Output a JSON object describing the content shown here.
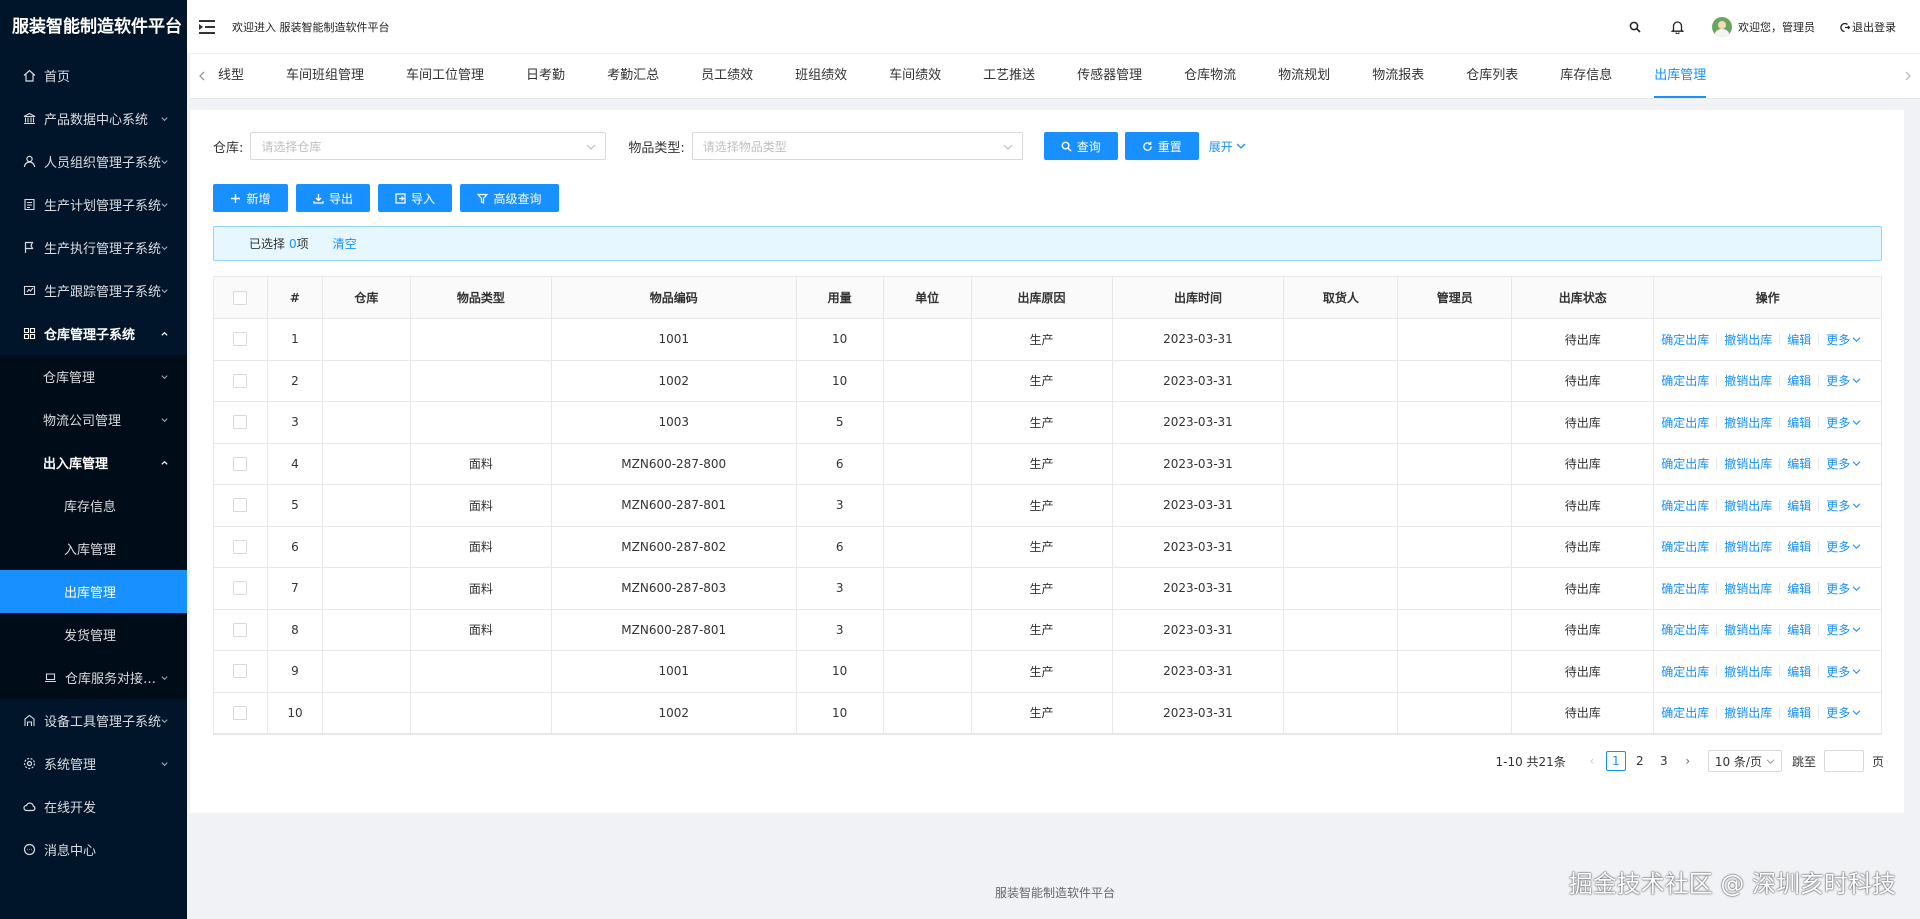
{
  "app": {
    "title": "服装智能制造软件平台",
    "welcome": "欢迎进入 服装智能制造软件平台",
    "user_greeting": "欢迎您，管理员",
    "logout": "退出登录",
    "footer": "服装智能制造软件平台",
    "watermark": "掘金技术社区 @ 深圳亥时科技"
  },
  "sidebar": {
    "items": [
      {
        "label": "首页",
        "icon": "home-icon"
      },
      {
        "label": "产品数据中心系统",
        "icon": "bank-icon"
      },
      {
        "label": "人员组织管理子系统",
        "icon": "user-icon"
      },
      {
        "label": "生产计划管理子系统",
        "icon": "schedule-icon"
      },
      {
        "label": "生产执行管理子系统",
        "icon": "flag-icon"
      },
      {
        "label": "生产跟踪管理子系统",
        "icon": "track-icon"
      },
      {
        "label": "仓库管理子系统",
        "icon": "appstore-icon"
      },
      {
        "label": "设备工具管理子系统",
        "icon": "tool-icon"
      },
      {
        "label": "系统管理",
        "icon": "setting-icon"
      },
      {
        "label": "在线开发",
        "icon": "cloud-icon"
      },
      {
        "label": "消息中心",
        "icon": "message-icon"
      }
    ],
    "warehouse_sub": [
      {
        "label": "仓库管理"
      },
      {
        "label": "物流公司管理"
      },
      {
        "label": "出入库管理"
      },
      {
        "label": "仓库服务对接…"
      }
    ],
    "inout_sub": [
      {
        "label": "库存信息"
      },
      {
        "label": "入库管理"
      },
      {
        "label": "出库管理"
      },
      {
        "label": "发货管理"
      }
    ]
  },
  "tabs": [
    "线型",
    "车间班组管理",
    "车间工位管理",
    "日考勤",
    "考勤汇总",
    "员工绩效",
    "班组绩效",
    "车间绩效",
    "工艺推送",
    "传感器管理",
    "仓库物流",
    "物流规划",
    "物流报表",
    "仓库列表",
    "库存信息",
    "出库管理"
  ],
  "active_tab": "出库管理",
  "search": {
    "warehouse_label": "仓库:",
    "warehouse_placeholder": "请选择仓库",
    "type_label": "物品类型:",
    "type_placeholder": "请选择物品类型",
    "query": "查询",
    "reset": "重置",
    "expand": "展开"
  },
  "toolbar": {
    "add": "新增",
    "export": "导出",
    "import": "导入",
    "advanced": "高级查询"
  },
  "selection": {
    "prefix": "已选择",
    "count": "0",
    "suffix": "项",
    "clear": "清空"
  },
  "table": {
    "columns": [
      "#",
      "仓库",
      "物品类型",
      "物品编码",
      "用量",
      "单位",
      "出库原因",
      "出库时间",
      "取货人",
      "管理员",
      "出库状态",
      "操作"
    ],
    "rows": [
      {
        "no": "1",
        "warehouse": "",
        "type": "",
        "code": "1001",
        "qty": "10",
        "unit": "",
        "reason": "生产",
        "time": "2023-03-31",
        "picker": "",
        "admin": "",
        "status": "待出库"
      },
      {
        "no": "2",
        "warehouse": "",
        "type": "",
        "code": "1002",
        "qty": "10",
        "unit": "",
        "reason": "生产",
        "time": "2023-03-31",
        "picker": "",
        "admin": "",
        "status": "待出库"
      },
      {
        "no": "3",
        "warehouse": "",
        "type": "",
        "code": "1003",
        "qty": "5",
        "unit": "",
        "reason": "生产",
        "time": "2023-03-31",
        "picker": "",
        "admin": "",
        "status": "待出库"
      },
      {
        "no": "4",
        "warehouse": "",
        "type": "面料",
        "code": "MZN600-287-800",
        "qty": "6",
        "unit": "",
        "reason": "生产",
        "time": "2023-03-31",
        "picker": "",
        "admin": "",
        "status": "待出库"
      },
      {
        "no": "5",
        "warehouse": "",
        "type": "面料",
        "code": "MZN600-287-801",
        "qty": "3",
        "unit": "",
        "reason": "生产",
        "time": "2023-03-31",
        "picker": "",
        "admin": "",
        "status": "待出库"
      },
      {
        "no": "6",
        "warehouse": "",
        "type": "面料",
        "code": "MZN600-287-802",
        "qty": "6",
        "unit": "",
        "reason": "生产",
        "time": "2023-03-31",
        "picker": "",
        "admin": "",
        "status": "待出库"
      },
      {
        "no": "7",
        "warehouse": "",
        "type": "面料",
        "code": "MZN600-287-803",
        "qty": "3",
        "unit": "",
        "reason": "生产",
        "time": "2023-03-31",
        "picker": "",
        "admin": "",
        "status": "待出库"
      },
      {
        "no": "8",
        "warehouse": "",
        "type": "面料",
        "code": "MZN600-287-801",
        "qty": "3",
        "unit": "",
        "reason": "生产",
        "time": "2023-03-31",
        "picker": "",
        "admin": "",
        "status": "待出库"
      },
      {
        "no": "9",
        "warehouse": "",
        "type": "",
        "code": "1001",
        "qty": "10",
        "unit": "",
        "reason": "生产",
        "time": "2023-03-31",
        "picker": "",
        "admin": "",
        "status": "待出库"
      },
      {
        "no": "10",
        "warehouse": "",
        "type": "",
        "code": "1002",
        "qty": "10",
        "unit": "",
        "reason": "生产",
        "time": "2023-03-31",
        "picker": "",
        "admin": "",
        "status": "待出库"
      }
    ],
    "actions": {
      "confirm": "确定出库",
      "cancel": "撤销出库",
      "edit": "编辑",
      "more": "更多"
    }
  },
  "pagination": {
    "total": "1-10 共21条",
    "pages": [
      "1",
      "2",
      "3"
    ],
    "current": "1",
    "page_size": "10 条/页",
    "jump_label": "跳至",
    "page_suffix": "页"
  },
  "colors": {
    "primary": "#1890ff",
    "sidebar_bg": "#001529"
  }
}
